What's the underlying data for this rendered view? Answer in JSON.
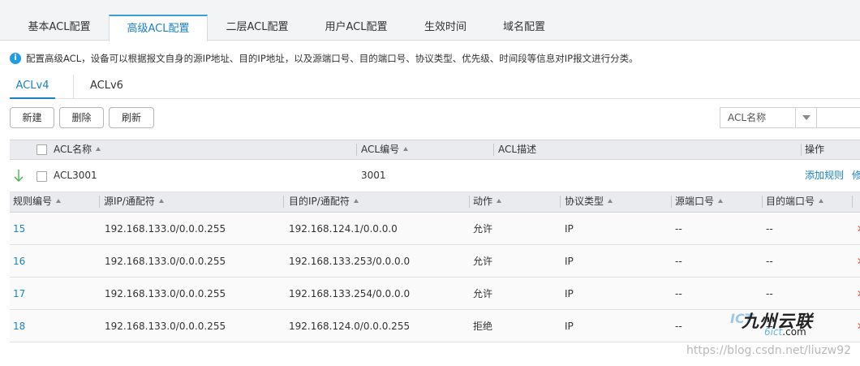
{
  "tabs": [
    {
      "label": "基本ACL配置"
    },
    {
      "label": "高级ACL配置"
    },
    {
      "label": "二层ACL配置"
    },
    {
      "label": "用户ACL配置"
    },
    {
      "label": "生效时间"
    },
    {
      "label": "域名配置"
    }
  ],
  "active_tab": "高级ACL配置",
  "info": {
    "icon": "info-icon",
    "text": "配置高级ACL，设备可以根据报文自身的源IP地址、目的IP地址，以及源端口号、目的端口号、协议类型、优先级、时间段等信息对IP报文进行分类。"
  },
  "subtabs": [
    {
      "label": "ACLv4"
    },
    {
      "label": "ACLv6"
    }
  ],
  "active_subtab": "ACLv4",
  "toolbar": {
    "new_label": "新建",
    "delete_label": "删除",
    "refresh_label": "刷新"
  },
  "search": {
    "field_selected": "ACL名称",
    "value": ""
  },
  "acl_table": {
    "columns": [
      "ACL名称",
      "ACL编号",
      "ACL描述",
      "操作"
    ],
    "rows": [
      {
        "name": "ACL3001",
        "number": "3001",
        "description": "",
        "action_add_rule": "添加规则",
        "action_edit_partial": "修"
      }
    ]
  },
  "rule_table": {
    "columns": [
      "规则编号",
      "源IP/通配符",
      "目的IP/通配符",
      "动作",
      "协议类型",
      "源端口号",
      "目的端口号"
    ],
    "rows": [
      {
        "id": "15",
        "src": "192.168.133.0/0.0.0.255",
        "dst": "192.168.124.1/0.0.0.0",
        "action": "允许",
        "protocol": "IP",
        "src_port": "--",
        "dst_port": "--"
      },
      {
        "id": "16",
        "src": "192.168.133.0/0.0.0.255",
        "dst": "192.168.133.253/0.0.0.0",
        "action": "允许",
        "protocol": "IP",
        "src_port": "--",
        "dst_port": "--"
      },
      {
        "id": "17",
        "src": "192.168.133.0/0.0.0.255",
        "dst": "192.168.133.254/0.0.0.0",
        "action": "允许",
        "protocol": "IP",
        "src_port": "--",
        "dst_port": "--"
      },
      {
        "id": "18",
        "src": "192.168.133.0/0.0.0.255",
        "dst": "192.168.124.0/0.0.0.255",
        "action": "拒绝",
        "protocol": "IP",
        "src_port": "--",
        "dst_port": "--"
      }
    ]
  },
  "watermark": {
    "logo_ict": "ICT",
    "logo_main": "九州云联",
    "logo_sub_highlight": "6ict",
    ".com_suffix": ".com",
    "text": "https://blog.csdn.net/liuzw92"
  },
  "colors": {
    "accent": "#1b82c4",
    "info_icon": "#1f9ee6",
    "header_bg": "#e9ebee",
    "tab_bar_bg": "#f3f4f6",
    "delete_mark": "#e04a3a"
  }
}
